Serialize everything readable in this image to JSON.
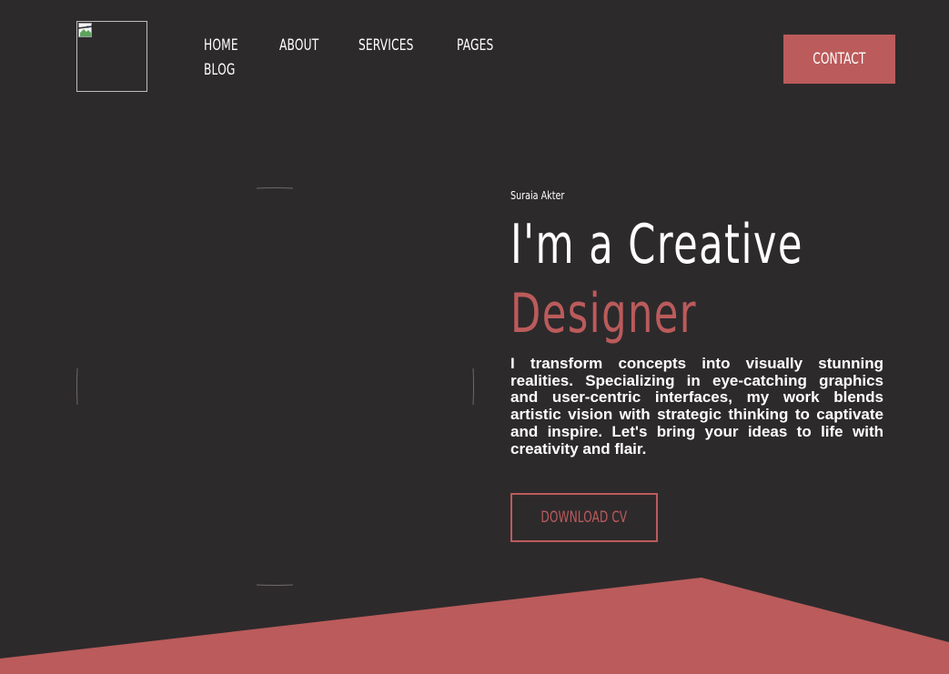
{
  "header": {
    "logo_alt": "",
    "nav": [
      {
        "label": "HOME"
      },
      {
        "label": "ABOUT"
      },
      {
        "label": "SERVICES"
      },
      {
        "label": "PAGES"
      },
      {
        "label": "BLOG"
      }
    ],
    "contact_label": "CONTACT"
  },
  "hero": {
    "name": "Suraia Akter",
    "headline_line1": "I'm a Creative",
    "headline_line2": "Designer",
    "description": "I transform concepts into visually stunning realities. Specializing in eye-catching graphics and user-centric interfaces, my work blends artistic vision with strategic thinking to captivate and inspire. Let's bring your ideas to life with creativity and flair.",
    "cv_label": "DOWNLOAD CV"
  },
  "colors": {
    "background": "#2d2a2c",
    "accent": "#bb5b5b",
    "text": "#ffffff"
  },
  "icons": {
    "logo": "broken-image-icon"
  }
}
